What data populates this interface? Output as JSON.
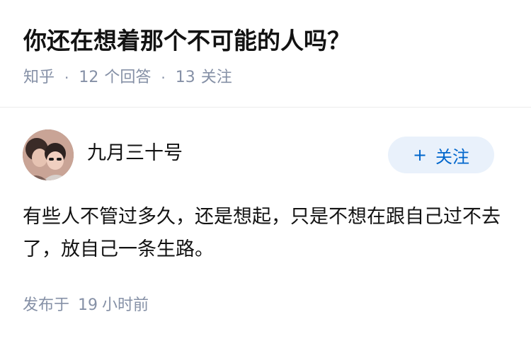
{
  "question": {
    "title": "你还在想着那个不可能的人吗？",
    "source": "知乎",
    "separator": "·",
    "answer_count": "12",
    "answer_label": "个回答",
    "follow_count": "13",
    "follow_label": "关注"
  },
  "answer": {
    "author_name": "九月三十号",
    "follow_button": {
      "icon": "+",
      "label": "关注"
    },
    "content": "有些人不管过多久，还是想起，只是不想在跟自己过不去了，放自己一条生路。",
    "time_prefix": "发布于",
    "time_value": "19",
    "time_suffix": "小时前"
  },
  "colors": {
    "title": "#121212",
    "meta": "#8590a6",
    "follow_bg": "#e9f1fb",
    "follow_text": "#0066cc",
    "divider": "#ebebeb"
  }
}
